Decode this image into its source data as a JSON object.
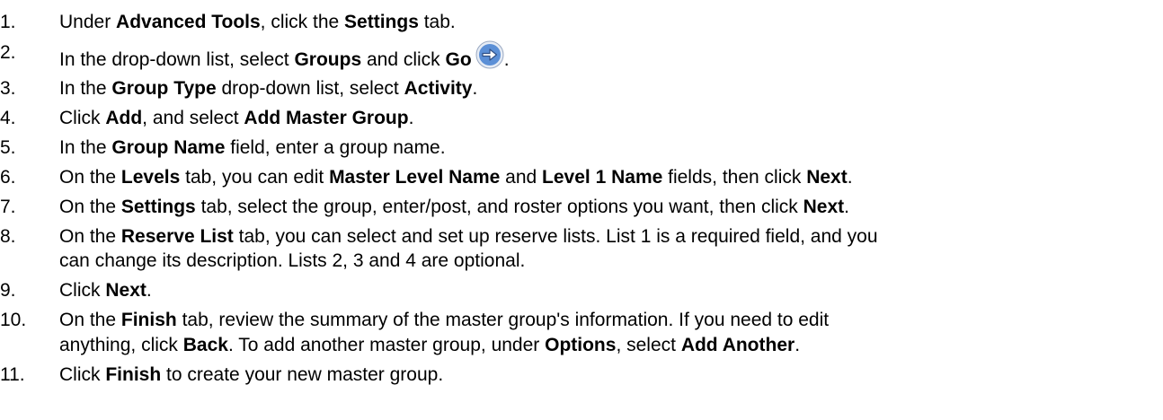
{
  "steps": [
    {
      "num": "1.",
      "parts": [
        {
          "t": "Under "
        },
        {
          "t": "Advanced Tools",
          "b": true
        },
        {
          "t": ", click the "
        },
        {
          "t": "Settings",
          "b": true
        },
        {
          "t": " tab."
        }
      ]
    },
    {
      "num": "2.",
      "parts": [
        {
          "t": "In the drop-down list, select "
        },
        {
          "t": "Groups",
          "b": true
        },
        {
          "t": " and click "
        },
        {
          "t": "Go",
          "b": true
        },
        {
          "icon": "go-arrow-icon"
        },
        {
          "t": "."
        }
      ]
    },
    {
      "num": "3.",
      "parts": [
        {
          "t": "In the "
        },
        {
          "t": "Group Type",
          "b": true
        },
        {
          "t": " drop-down list, select "
        },
        {
          "t": "Activity",
          "b": true
        },
        {
          "t": "."
        }
      ]
    },
    {
      "num": "4.",
      "parts": [
        {
          "t": "Click "
        },
        {
          "t": "Add",
          "b": true
        },
        {
          "t": ", and select "
        },
        {
          "t": "Add Master Group",
          "b": true
        },
        {
          "t": "."
        }
      ]
    },
    {
      "num": "5.",
      "parts": [
        {
          "t": "In the "
        },
        {
          "t": "Group Name",
          "b": true
        },
        {
          "t": " field, enter a group name."
        }
      ]
    },
    {
      "num": "6.",
      "parts": [
        {
          "t": "On the "
        },
        {
          "t": "Levels",
          "b": true
        },
        {
          "t": " tab, you can edit "
        },
        {
          "t": "Master Level Name",
          "b": true
        },
        {
          "t": " and "
        },
        {
          "t": "Level 1 Name",
          "b": true
        },
        {
          "t": " fields, then click "
        },
        {
          "t": "Next",
          "b": true
        },
        {
          "t": "."
        }
      ]
    },
    {
      "num": "7.",
      "parts": [
        {
          "t": "On the "
        },
        {
          "t": "Settings",
          "b": true
        },
        {
          "t": " tab, select the group, enter/post, and roster options you want, then click "
        },
        {
          "t": "Next",
          "b": true
        },
        {
          "t": "."
        }
      ]
    },
    {
      "num": "8.",
      "parts": [
        {
          "t": "On the "
        },
        {
          "t": "Reserve List",
          "b": true
        },
        {
          "t": " tab, you can select and set up reserve lists. List 1 is a required field, and you"
        },
        {
          "br": true
        },
        {
          "t": "can change its description. Lists 2, 3 and 4 are optional."
        }
      ]
    },
    {
      "num": "9.",
      "parts": [
        {
          "t": "Click "
        },
        {
          "t": "Next",
          "b": true
        },
        {
          "t": "."
        }
      ]
    },
    {
      "num": "10.",
      "parts": [
        {
          "t": "On the "
        },
        {
          "t": "Finish",
          "b": true
        },
        {
          "t": " tab, review the summary of the master group's information. If you need to edit"
        },
        {
          "br": true
        },
        {
          "t": "anything, click "
        },
        {
          "t": "Back",
          "b": true
        },
        {
          "t": ". To add another master group, under "
        },
        {
          "t": "Options",
          "b": true
        },
        {
          "t": ", select "
        },
        {
          "t": "Add Another",
          "b": true
        },
        {
          "t": "."
        }
      ]
    },
    {
      "num": "11.",
      "parts": [
        {
          "t": "Click "
        },
        {
          "t": "Finish",
          "b": true
        },
        {
          "t": " to create your new master group."
        }
      ]
    }
  ],
  "colors": {
    "go_icon_fill": "#5b8fd6",
    "go_icon_ring": "#e6ecf5",
    "go_icon_arrow": "#ffffff"
  }
}
